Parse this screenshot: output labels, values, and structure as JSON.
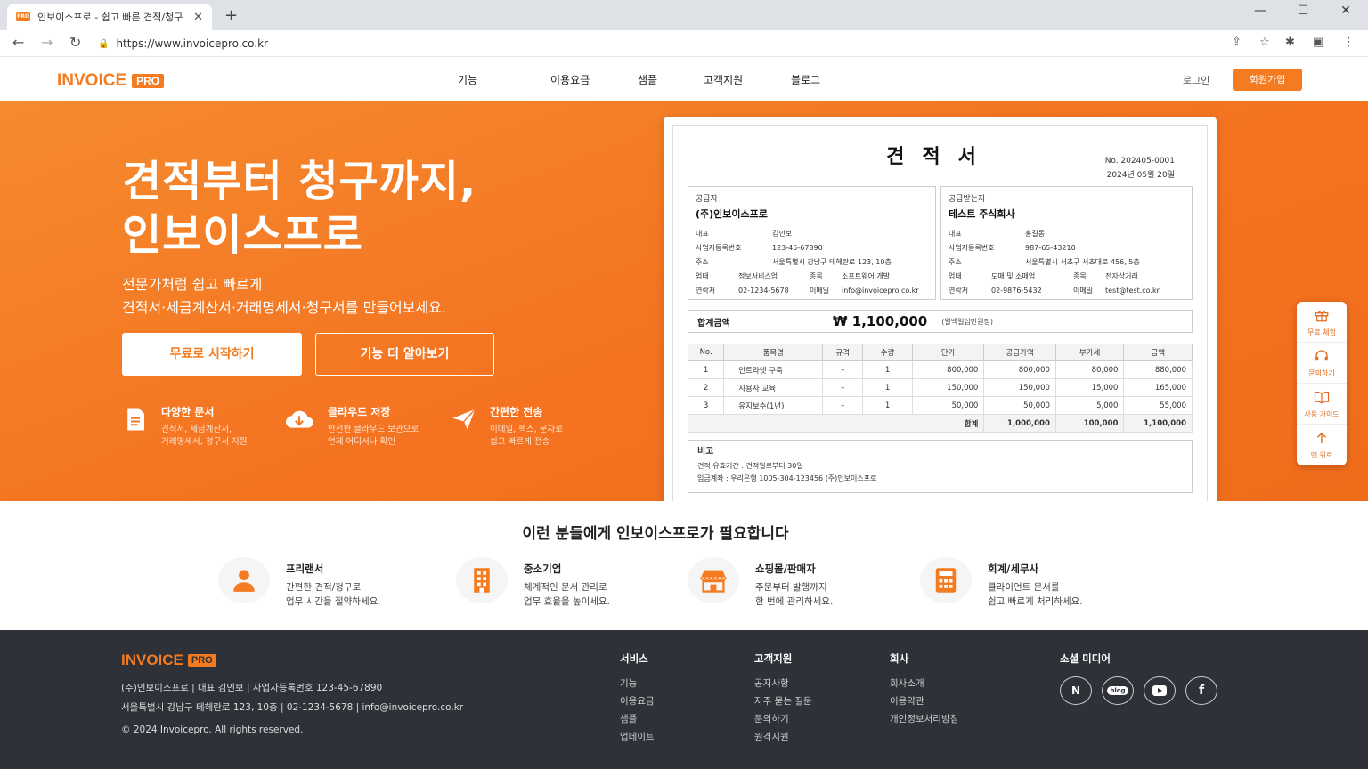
{
  "browser": {
    "tab_title": "인보이스프로 - 쉽고 빠른 견적/청구",
    "favicon_text": "PRO",
    "url": "https://www.invoicepro.co.kr"
  },
  "header": {
    "logo": "INVOICE",
    "logo_badge": "PRO",
    "nav": [
      "기능",
      "이용요금",
      "샘플",
      "고객지원",
      "블로그"
    ],
    "login": "로그인",
    "signup": "회원가입"
  },
  "hero": {
    "title_line1": "견적부터 청구까지,",
    "title_line2": "인보이스프로",
    "sub_line1": "전문가처럼 쉽고 빠르게",
    "sub_line2": "견적서·세금계산서·거래명세서·청구서를 만들어보세요.",
    "btn_start": "무료로 시작하기",
    "btn_more": "기능 더 알아보기",
    "features": [
      {
        "icon": "document-icon",
        "title": "다양한 문서",
        "desc1": "견적서, 세금계산서,",
        "desc2": "거래명세서, 청구서 지원"
      },
      {
        "icon": "cloud-download-icon",
        "title": "클라우드 저장",
        "desc1": "안전한 클라우드 보관으로",
        "desc2": "언제 어디서나 확인"
      },
      {
        "icon": "send-icon",
        "title": "간편한 전송",
        "desc1": "이메일, 팩스, 문자로",
        "desc2": "쉽고 빠르게 전송"
      }
    ]
  },
  "quote": {
    "title": "견적서",
    "number": "No. 202405-0001",
    "date": "2024년 05월 20일",
    "supplier": {
      "role": "공급자",
      "name": "(주)인보이스프로",
      "rep_label": "대표",
      "rep": "김인보",
      "biz_label": "사업자등록번호",
      "biz": "123-45-67890",
      "addr_label": "주소",
      "addr": "서울특별시 강남구 테헤란로 123, 10층",
      "type_label": "업태",
      "type": "정보서비스업",
      "item_label": "종목",
      "item": "소프트웨어 개발",
      "tel_label": "연락처",
      "tel": "02-1234-5678",
      "email_label": "이메일",
      "email": "info@invoicepro.co.kr"
    },
    "client": {
      "role": "공급받는자",
      "name": "테스트 주식회사",
      "rep_label": "대표",
      "rep": "홍길동",
      "biz_label": "사업자등록번호",
      "biz": "987-65-43210",
      "addr_label": "주소",
      "addr": "서울특별시 서초구 서초대로 456, 5층",
      "type_label": "업태",
      "type": "도매 및 소매업",
      "item_label": "종목",
      "item": "전자상거래",
      "tel_label": "연락처",
      "tel": "02-9876-5432",
      "email_label": "이메일",
      "email": "test@test.co.kr"
    },
    "total_label": "합계금액",
    "total": "₩ 1,100,000",
    "total_korean": "(일백일십만원정)",
    "columns": [
      "No.",
      "품목명",
      "규격",
      "수량",
      "단가",
      "공급가액",
      "부가세",
      "금액"
    ],
    "rows": [
      [
        "1",
        "인트라넷 구축",
        "–",
        "1",
        "800,000",
        "800,000",
        "80,000",
        "880,000"
      ],
      [
        "2",
        "사용자 교육",
        "–",
        "1",
        "150,000",
        "150,000",
        "15,000",
        "165,000"
      ],
      [
        "3",
        "유지보수(1년)",
        "–",
        "1",
        "50,000",
        "50,000",
        "5,000",
        "55,000"
      ]
    ],
    "sum_label": "합계",
    "sum_supply": "1,000,000",
    "sum_vat": "100,000",
    "sum_total": "1,100,000",
    "remark_title": "비고",
    "remark_line1": "견적 유효기간 : 견적일로부터 30일",
    "remark_line2": "입금계좌 : 우리은행 1005-304-123456 (주)인보이스프로"
  },
  "sidemenu": [
    {
      "icon": "gift-icon",
      "label": "무료 체험"
    },
    {
      "icon": "headset-icon",
      "label": "문의하기"
    },
    {
      "icon": "book-icon",
      "label": "사용 가이드"
    },
    {
      "icon": "arrow-up-icon",
      "label": "맨 위로"
    }
  ],
  "target": {
    "title": "이런 분들에게 인보이스프로가 필요합니다",
    "personas": [
      {
        "icon": "person-icon",
        "title": "프리랜서",
        "desc1": "간편한 견적/청구로",
        "desc2": "업무 시간을 절약하세요."
      },
      {
        "icon": "building-icon",
        "title": "중소기업",
        "desc1": "체계적인 문서 관리로",
        "desc2": "업무 효율을 높이세요."
      },
      {
        "icon": "store-icon",
        "title": "쇼핑몰/판매자",
        "desc1": "주문부터 발행까지",
        "desc2": "한 번에 관리하세요."
      },
      {
        "icon": "calculator-icon",
        "title": "회계/세무사",
        "desc1": "클라이언트 문서를",
        "desc2": "쉽고 빠르게 처리하세요."
      }
    ]
  },
  "footer": {
    "logo": "INVOICE",
    "logo_badge": "PRO",
    "info1": "(주)인보이스프로  |  대표 김인보  |  사업자등록번호 123-45-67890",
    "info2": "서울특별시 강남구 테헤란로 123, 10층  |  02-1234-5678  |  info@invoicepro.co.kr",
    "copyright": "© 2024 Invoicepro. All rights reserved.",
    "columns": [
      {
        "title": "서비스",
        "links": [
          "기능",
          "이용요금",
          "샘플",
          "업데이트"
        ]
      },
      {
        "title": "고객지원",
        "links": [
          "공지사항",
          "자주 묻는 질문",
          "문의하기",
          "원격지원"
        ]
      },
      {
        "title": "회사",
        "links": [
          "회사소개",
          "이용약관",
          "개인정보처리방침"
        ]
      }
    ],
    "social_title": "소셜 미디어",
    "social": [
      {
        "icon": "naver-icon",
        "text": "N"
      },
      {
        "icon": "blog-icon",
        "text": "blog"
      },
      {
        "icon": "youtube-icon",
        "text": ""
      },
      {
        "icon": "facebook-icon",
        "text": "f"
      }
    ]
  },
  "colors": {
    "brand": "#f47b20",
    "footer_bg": "#2e3138"
  }
}
